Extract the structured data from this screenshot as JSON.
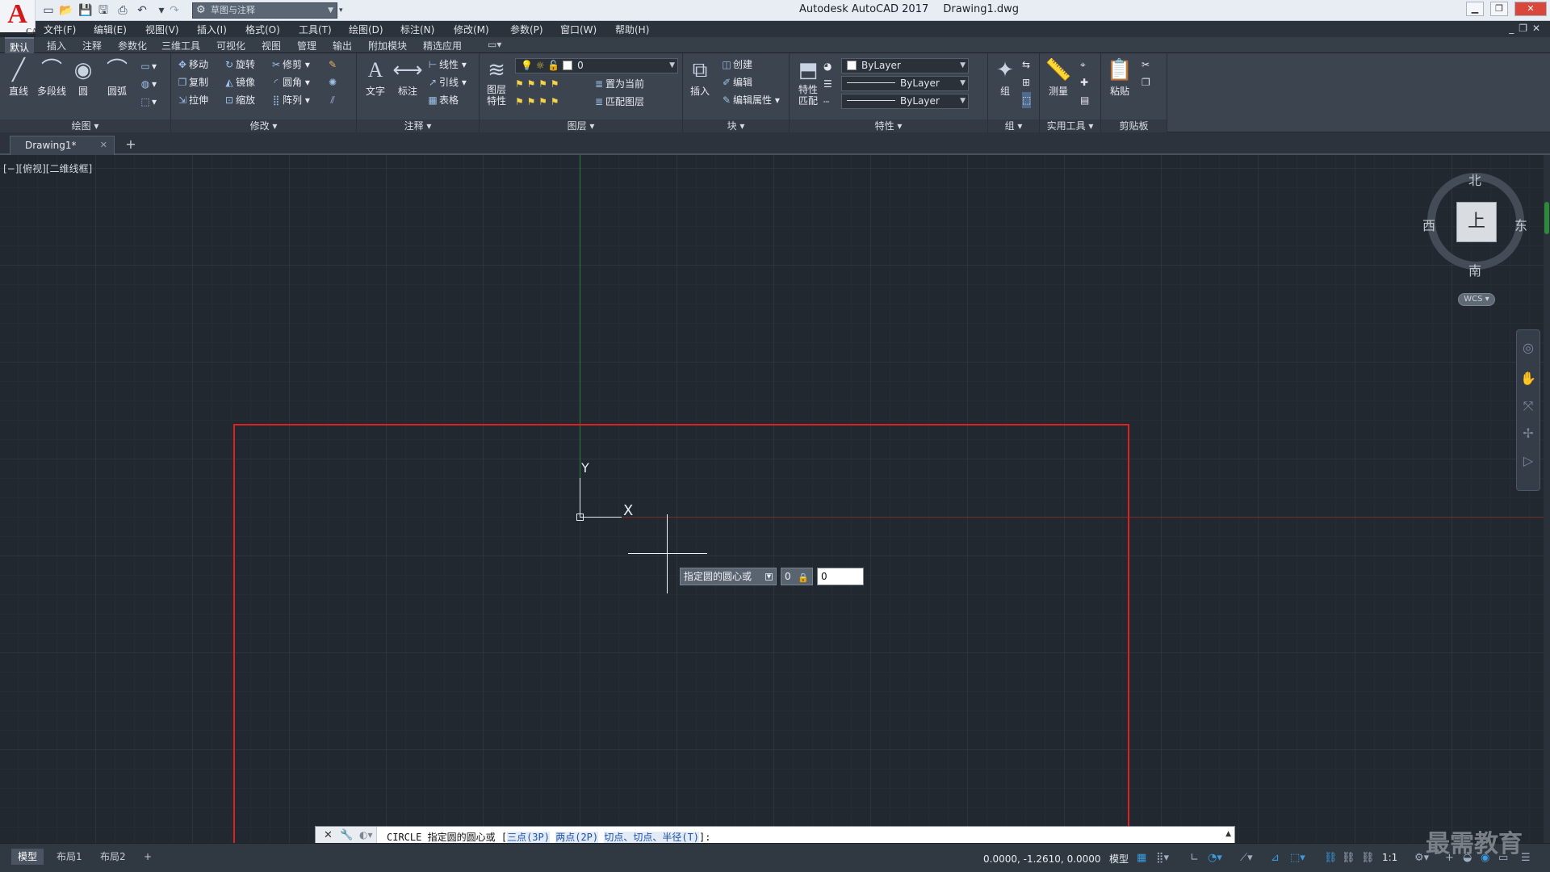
{
  "window": {
    "app_name": "Autodesk AutoCAD 2017",
    "document": "Drawing1.dwg",
    "logo_letter": "A",
    "logo_sub": "CAD"
  },
  "qat": {
    "workspace": "草图与注释"
  },
  "menu": [
    "文件(F)",
    "编辑(E)",
    "视图(V)",
    "插入(I)",
    "格式(O)",
    "工具(T)",
    "绘图(D)",
    "标注(N)",
    "修改(M)",
    "参数(P)",
    "窗口(W)",
    "帮助(H)"
  ],
  "ribbon_tabs": [
    "默认",
    "插入",
    "注释",
    "参数化",
    "三维工具",
    "可视化",
    "视图",
    "管理",
    "输出",
    "附加模块",
    "精选应用"
  ],
  "panels": {
    "draw": {
      "title": "绘图",
      "line": "直线",
      "polyline": "多段线",
      "circle": "圆",
      "arc": "圆弧"
    },
    "modify": {
      "title": "修改",
      "move": "移动",
      "rotate": "旋转",
      "trim": "修剪",
      "copy": "复制",
      "mirror": "镜像",
      "fillet": "圆角",
      "stretch": "拉伸",
      "scale": "缩放",
      "array": "阵列"
    },
    "annotation": {
      "title": "注释",
      "text": "文字",
      "dimension": "标注",
      "linear": "线性",
      "leader": "引线",
      "table": "表格"
    },
    "layers": {
      "title": "图层",
      "layer_props_1": "图层",
      "layer_props_2": "特性",
      "current_layer": "0",
      "set_current": "置为当前",
      "match_layer": "匹配图层"
    },
    "block": {
      "title": "块",
      "insert": "插入",
      "create": "创建",
      "edit": "编辑",
      "edit_attr": "编辑属性"
    },
    "properties": {
      "title": "特性",
      "match_1": "特性",
      "match_2": "匹配",
      "color": "ByLayer",
      "linetype": "ByLayer",
      "lineweight": "ByLayer"
    },
    "groups": {
      "title": "组",
      "group": "组"
    },
    "utilities": {
      "title": "实用工具",
      "measure": "测量"
    },
    "clipboard": {
      "title": "剪贴板",
      "paste": "粘贴"
    }
  },
  "file_tabs": [
    {
      "name": "Drawing1*"
    }
  ],
  "viewport": {
    "label": "[−][俯视][二维线框]",
    "ucs_y": "Y",
    "ucs_x": "X"
  },
  "viewcube": {
    "north": "北",
    "south": "南",
    "east": "东",
    "west": "西",
    "face": "上",
    "wcs": "WCS"
  },
  "dynamic_input": {
    "prompt": "指定圆的圆心或",
    "x_value": "0",
    "y_value": "0"
  },
  "command_line": {
    "command": "CIRCLE",
    "prompt": "指定圆的圆心或",
    "bracket_open": "[",
    "opt1": "三点(3P)",
    "opt2": "两点(2P)",
    "opt3": "切点、切点、半径(T)",
    "bracket_close": "]:"
  },
  "layout_tabs": [
    "模型",
    "布局1",
    "布局2"
  ],
  "status": {
    "coords": "0.0000, -1.2610, 0.0000",
    "model": "模型",
    "scale": "1:1"
  },
  "watermark": "最需教育"
}
